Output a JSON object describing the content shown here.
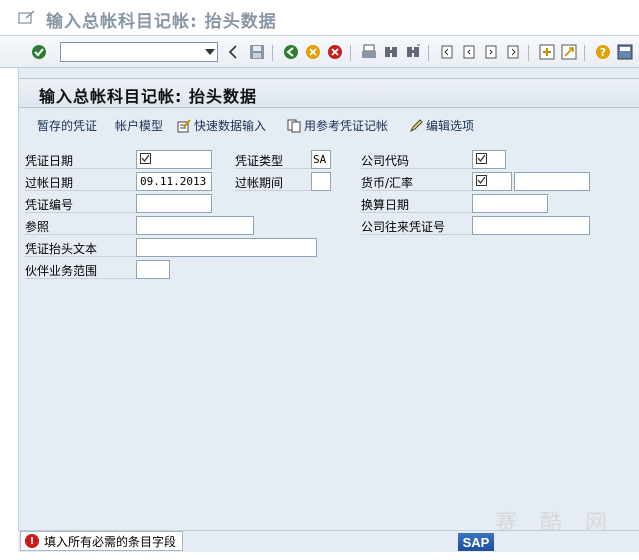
{
  "window": {
    "title": "输入总帐科目记帐: 抬头数据"
  },
  "toolbar": {
    "command_field_value": "",
    "icons": [
      "enter-icon",
      "back-nav-icon",
      "save-icon",
      "back-icon",
      "exit-icon",
      "cancel-icon",
      "print-icon",
      "find-icon",
      "find-next-icon",
      "first-page-icon",
      "previous-page-icon",
      "next-page-icon",
      "last-page-icon",
      "create-session-icon",
      "shortcut-icon",
      "help-icon",
      "customize-layout-icon"
    ]
  },
  "header": {
    "title": "输入总帐科目记帐: 抬头数据"
  },
  "appbar": {
    "park_doc": "暂存的凭证",
    "account_model": "帐户模型",
    "fast_entry": "快速数据输入",
    "post_with_ref": "用参考凭证记帐",
    "edit_options": "编辑选项"
  },
  "form": {
    "doc_date_label": "凭证日期",
    "posting_date_label": "过帐日期",
    "posting_date_value": "09.11.2013",
    "doc_number_label": "凭证编号",
    "reference_label": "参照",
    "header_text_label": "凭证抬头文本",
    "trading_partner_label": "伙伴业务范围",
    "doc_type_label": "凭证类型",
    "doc_type_value": "SA",
    "period_label": "过帐期间",
    "company_code_label": "公司代码",
    "currency_rate_label": "货币/汇率",
    "translation_date_label": "换算日期",
    "cross_cc_label": "公司往来凭证号"
  },
  "status": {
    "message": "填入所有必需的条目字段",
    "brand": "SAP"
  },
  "watermark": "赛 酷 网"
}
